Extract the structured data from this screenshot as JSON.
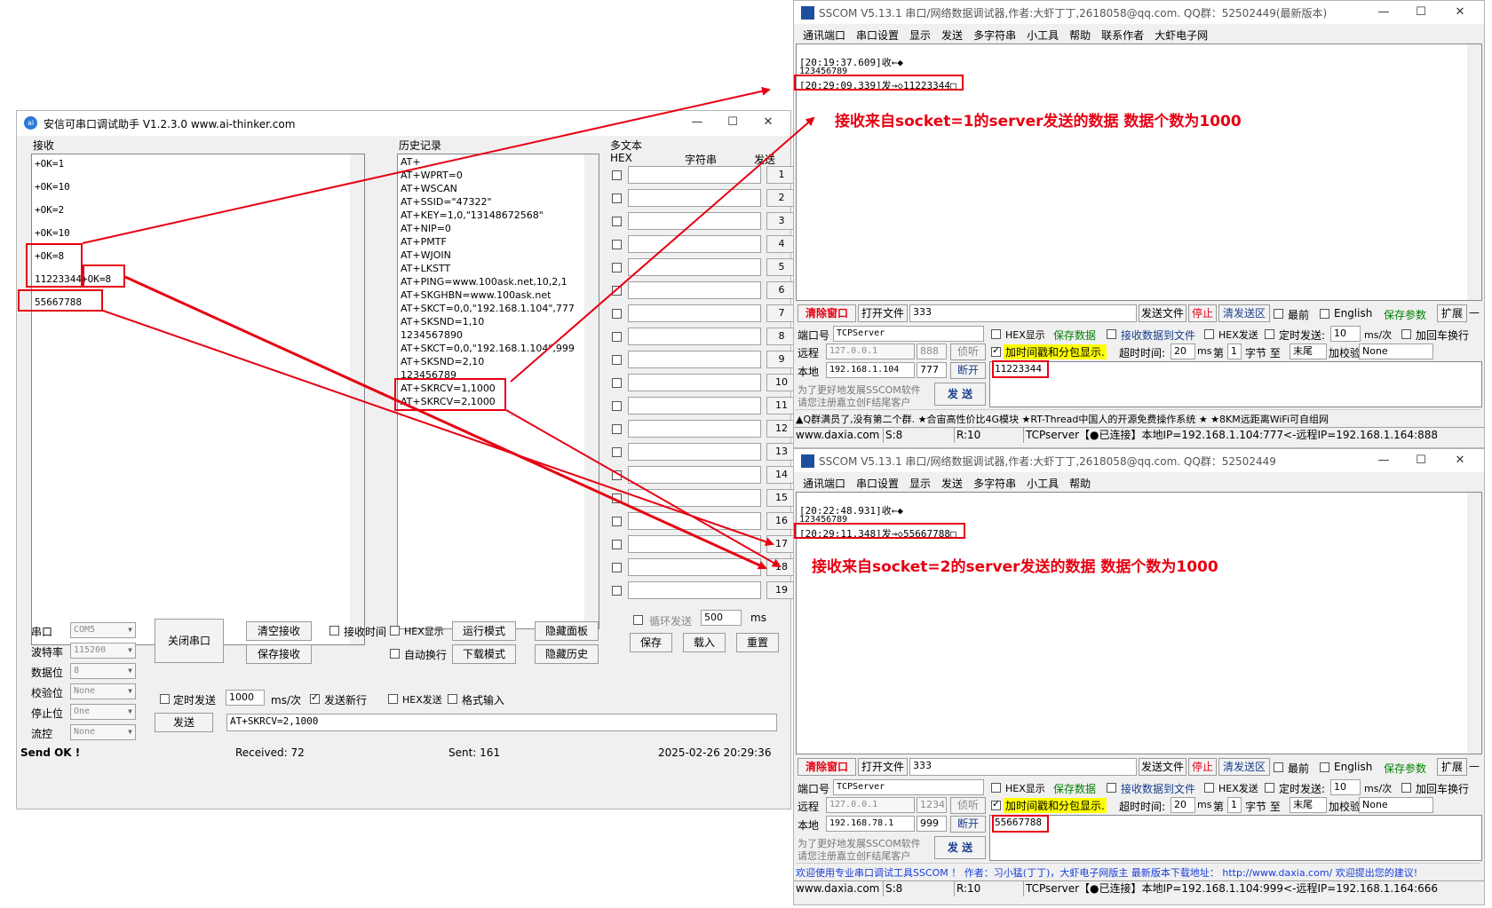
{
  "colors": {
    "annotation": "#e60012",
    "highlight": "#ffff00",
    "green_text": "#008000",
    "red_text": "#e60012"
  },
  "aithinker": {
    "title": "安信可串口调试助手 V1.2.3.0    www.ai-thinker.com",
    "receive_label": "接收",
    "receive_lines": [
      "+OK=1",
      "+OK=10",
      "+OK=2",
      "+OK=10",
      "+OK=8",
      "11223344+OK=8",
      "55667788"
    ],
    "history_label": "历史记录",
    "history_lines": [
      "AT+",
      "AT+WPRT=0",
      "AT+WSCAN",
      "AT+SSID=\"47322\"",
      "AT+KEY=1,0,\"13148672568\"",
      "AT+NIP=0",
      "AT+PMTF",
      "AT+WJOIN",
      "AT+LKSTT",
      "AT+PING=www.100ask.net,10,2,1",
      "AT+SKGHBN=www.100ask.net",
      "AT+SKCT=0,0,\"192.168.1.104\",777",
      "AT+SKSND=1,10",
      "1234567890",
      "AT+SKCT=0,0,\"192.168.1.104\",999",
      "AT+SKSND=2,10",
      "123456789",
      "AT+SKRCV=1,1000",
      "AT+SKRCV=2,1000"
    ],
    "multitext_label": "多文本",
    "col_hex": "HEX",
    "col_string": "字符串",
    "col_send": "发送",
    "send_buttons": [
      "1",
      "2",
      "3",
      "4",
      "5",
      "6",
      "7",
      "8",
      "9",
      "10",
      "11",
      "12",
      "13",
      "14",
      "15",
      "16",
      "17",
      "18",
      "19"
    ],
    "loop_send_label": "循环发送",
    "loop_ms_value": "500",
    "ms_label": "ms",
    "save_label": "保存",
    "load_label": "载入",
    "reset_label": "重置",
    "port_label": "串口",
    "port_value": "COM5",
    "baud_label": "波特率",
    "baud_value": "115200",
    "databits_label": "数据位",
    "databits_value": "8",
    "parity_label": "校验位",
    "parity_value": "None",
    "stopbits_label": "停止位",
    "stopbits_value": "One",
    "flow_label": "流控",
    "flow_value": "None",
    "close_port": "关闭串口",
    "clear_recv": "清空接收",
    "save_recv": "保存接收",
    "recv_time": "接收时间",
    "hex_display": "HEX显示",
    "run_mode": "运行模式",
    "hide_panel": "隐藏面板",
    "auto_wrap": "自动换行",
    "download_mode": "下载模式",
    "hide_history": "隐藏历史",
    "timed_send": "定时发送",
    "timed_value": "1000",
    "ms_per": "ms/次",
    "send_newline": "发送新行",
    "hex_send": "HEX发送",
    "format_input": "格式输入",
    "send": "发送",
    "send_text": "AT+SKRCV=2,1000",
    "status_send_ok": "Send OK !",
    "status_received": "Received: 72",
    "status_sent": "Sent: 161",
    "status_time": "2025-02-26 20:29:36"
  },
  "sscom1": {
    "title": "SSCOM V5.13.1 串口/网络数据调试器,作者:大虾丁丁,2618058@qq.com. QQ群：52502449(最新版本)",
    "menu": [
      "通讯端口",
      "串口设置",
      "显示",
      "发送",
      "多字符串",
      "小工具",
      "帮助",
      "联系作者",
      "大虾电子网"
    ],
    "log_line1": "[20:19:37.609]收←◆",
    "log_line2": "123456789",
    "log_line3": "[20:29:09.339]发→◇11223344□",
    "annotation": "接收来自socket=1的server发送的数据 数据个数为1000",
    "clear_window": "清除窗口",
    "open_file": "打开文件",
    "file_value": "333",
    "send_file": "发送文件",
    "stop": "停止",
    "clear_send": "清发送区",
    "latest": "最前",
    "english": "English",
    "save_params": "保存参数",
    "expand": "扩展",
    "dash": "—",
    "port_label": "端口号",
    "port_value": "TCPServer",
    "hex_show": "HEX显示",
    "save_data": "保存数据",
    "recv_to_file": "接收数据到文件",
    "hex_send": "HEX发送",
    "timed_send": "定时发送:",
    "timed_value": "10",
    "ms_per": "ms/次",
    "add_crlf": "加回车换行",
    "remote_label": "远程",
    "remote_ip": "127.0.0.1",
    "remote_port": "888",
    "listen": "侦听",
    "timestamp_label": "加时间戳和分包显示.",
    "timeout_label": "超时时间:",
    "timeout_value": "20",
    "ms": "ms",
    "nth": "第",
    "nth_value": "1",
    "byte_label": "字节 至",
    "end_value": "末尾",
    "checksum": "加校验",
    "checksum_value": "None",
    "local_label": "本地",
    "local_ip": "192.168.1.104",
    "local_port": "777",
    "disconnect": "断开",
    "send_input": "11223344",
    "promo": "为了更好地发展SSCOM软件\n请您注册嘉立创F结尾客户",
    "send_btn": "发  送",
    "ticker": "▲Q群满员了,没有第二个群. ★合宙高性价比4G模块 ★RT-Thread中国人的开源免费操作系统 ★ ★8KM远距离WiFi可自组网",
    "status_site": "www.daxia.com",
    "status_s": "S:8",
    "status_r": "R:10",
    "status_conn": "TCPserver【●已连接】本地IP=192.168.1.104:777<-远程IP=192.168.1.164:888"
  },
  "sscom2": {
    "title": "SSCOM V5.13.1 串口/网络数据调试器,作者:大虾丁丁,2618058@qq.com. QQ群：52502449",
    "menu": [
      "通讯端口",
      "串口设置",
      "显示",
      "发送",
      "多字符串",
      "小工具",
      "帮助"
    ],
    "log_line1": "[20:22:48.931]收←◆",
    "log_line2": "123456789",
    "log_line3": "[20:29:11.348]发→◇55667788□",
    "annotation": "接收来自socket=2的server发送的数据 数据个数为1000",
    "clear_window": "清除窗口",
    "open_file": "打开文件",
    "file_value": "333",
    "send_file": "发送文件",
    "stop": "停止",
    "clear_send": "清发送区",
    "latest": "最前",
    "english": "English",
    "save_params": "保存参数",
    "expand": "扩展",
    "dash": "—",
    "port_label": "端口号",
    "port_value": "TCPServer",
    "hex_show": "HEX显示",
    "save_data": "保存数据",
    "recv_to_file": "接收数据到文件",
    "hex_send": "HEX发送",
    "timed_send": "定时发送:",
    "timed_value": "10",
    "ms_per": "ms/次",
    "add_crlf": "加回车换行",
    "remote_label": "远程",
    "remote_ip": "127.0.0.1",
    "remote_port": "1234",
    "listen": "侦听",
    "timestamp_label": "加时间戳和分包显示.",
    "timeout_label": "超时时间:",
    "timeout_value": "20",
    "ms": "ms",
    "nth": "第",
    "nth_value": "1",
    "byte_label": "字节 至",
    "end_value": "末尾",
    "checksum": "加校验",
    "checksum_value": "None",
    "local_label": "本地",
    "local_ip": "192.168.78.1",
    "local_port": "999",
    "disconnect": "断开",
    "send_input": "55667788",
    "promo": "为了更好地发展SSCOM软件\n请您注册嘉立创F结尾客户",
    "send_btn": "发  送",
    "ticker": "欢迎使用专业串口调试工具SSCOM ！   作者：习小猛(丁丁)，大虾电子网版主  最新版本下载地址： http://www.daxia.com/ 欢迎提出您的建议!",
    "status_site": "www.daxia.com",
    "status_s": "S:8",
    "status_r": "R:10",
    "status_conn": "TCPserver【●已连接】本地IP=192.168.1.104:999<-远程IP=192.168.1.164:666"
  }
}
